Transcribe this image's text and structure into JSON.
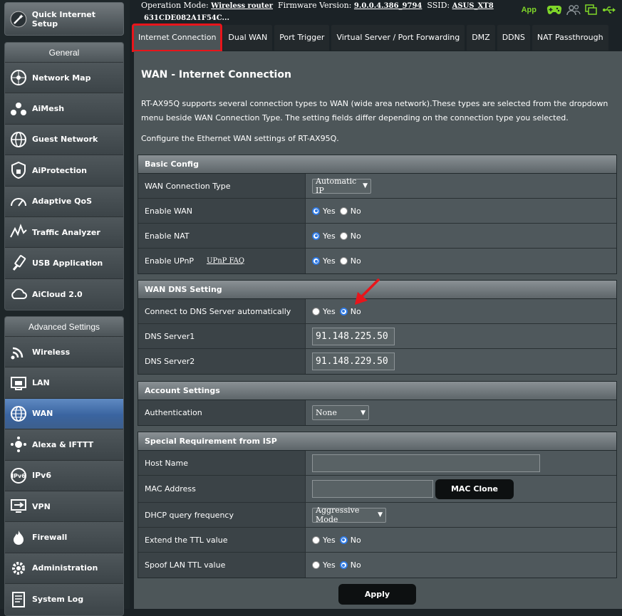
{
  "sidebar": {
    "qis_label": "Quick Internet Setup",
    "general_header": "General",
    "general_items": [
      {
        "label": "Network Map",
        "icon": "network-map-icon"
      },
      {
        "label": "AiMesh",
        "icon": "aimesh-icon"
      },
      {
        "label": "Guest Network",
        "icon": "guest-network-icon"
      },
      {
        "label": "AiProtection",
        "icon": "aiprotection-icon"
      },
      {
        "label": "Adaptive QoS",
        "icon": "adaptive-qos-icon"
      },
      {
        "label": "Traffic Analyzer",
        "icon": "traffic-analyzer-icon"
      },
      {
        "label": "USB Application",
        "icon": "usb-application-icon"
      },
      {
        "label": "AiCloud 2.0",
        "icon": "aicloud-icon"
      }
    ],
    "advanced_header": "Advanced Settings",
    "advanced_items": [
      {
        "label": "Wireless",
        "icon": "wireless-icon"
      },
      {
        "label": "LAN",
        "icon": "lan-icon"
      },
      {
        "label": "WAN",
        "icon": "wan-icon",
        "active": true
      },
      {
        "label": "Alexa & IFTTT",
        "icon": "alexa-icon"
      },
      {
        "label": "IPv6",
        "icon": "ipv6-icon"
      },
      {
        "label": "VPN",
        "icon": "vpn-icon"
      },
      {
        "label": "Firewall",
        "icon": "firewall-icon"
      },
      {
        "label": "Administration",
        "icon": "administration-icon"
      },
      {
        "label": "System Log",
        "icon": "system-log-icon"
      }
    ]
  },
  "top": {
    "op_mode_label": "Operation Mode:",
    "op_mode_value": "Wireless router",
    "fw_label": "Firmware Version:",
    "fw_value": "9.0.0.4.386_9794",
    "ssid_label": "SSID:",
    "ssid_value": "ASUS_XT8",
    "mac": "631CDE082A1F54C...",
    "app_label": "App"
  },
  "tabs": [
    "Internet Connection",
    "Dual WAN",
    "Port Trigger",
    "Virtual Server / Port Forwarding",
    "DMZ",
    "DDNS",
    "NAT Passthrough"
  ],
  "page": {
    "title": "WAN - Internet Connection",
    "description": "RT-AX95Q supports several connection types to WAN (wide area network).These types are selected from the dropdown menu beside WAN Connection Type. The setting fields differ depending on the connection type you selected.",
    "description2": "Configure the Ethernet WAN settings of RT-AX95Q."
  },
  "basic": {
    "header": "Basic Config",
    "wan_type_label": "WAN Connection Type",
    "wan_type_value": "Automatic IP",
    "enable_wan_label": "Enable WAN",
    "enable_nat_label": "Enable NAT",
    "enable_upnp_label": "Enable UPnP",
    "upnp_faq": "UPnP FAQ"
  },
  "radio": {
    "yes": "Yes",
    "no": "No"
  },
  "dns": {
    "header": "WAN DNS Setting",
    "auto_label": "Connect to DNS Server automatically",
    "dns1_label": "DNS Server1",
    "dns1_value": "91.148.225.50",
    "dns2_label": "DNS Server2",
    "dns2_value": "91.148.229.50"
  },
  "account": {
    "header": "Account Settings",
    "auth_label": "Authentication",
    "auth_value": "None"
  },
  "isp": {
    "header": "Special Requirement from ISP",
    "host_label": "Host Name",
    "host_value": "",
    "mac_label": "MAC Address",
    "mac_value": "",
    "mac_clone": "MAC Clone",
    "dhcp_label": "DHCP query frequency",
    "dhcp_value": "Aggressive Mode",
    "ttl_label": "Extend the TTL value",
    "spoof_label": "Spoof LAN TTL value"
  },
  "apply_label": "Apply",
  "colors": {
    "accent": "#2f7ae5",
    "highlight": "#e8151b",
    "app_green": "#7fd629"
  }
}
